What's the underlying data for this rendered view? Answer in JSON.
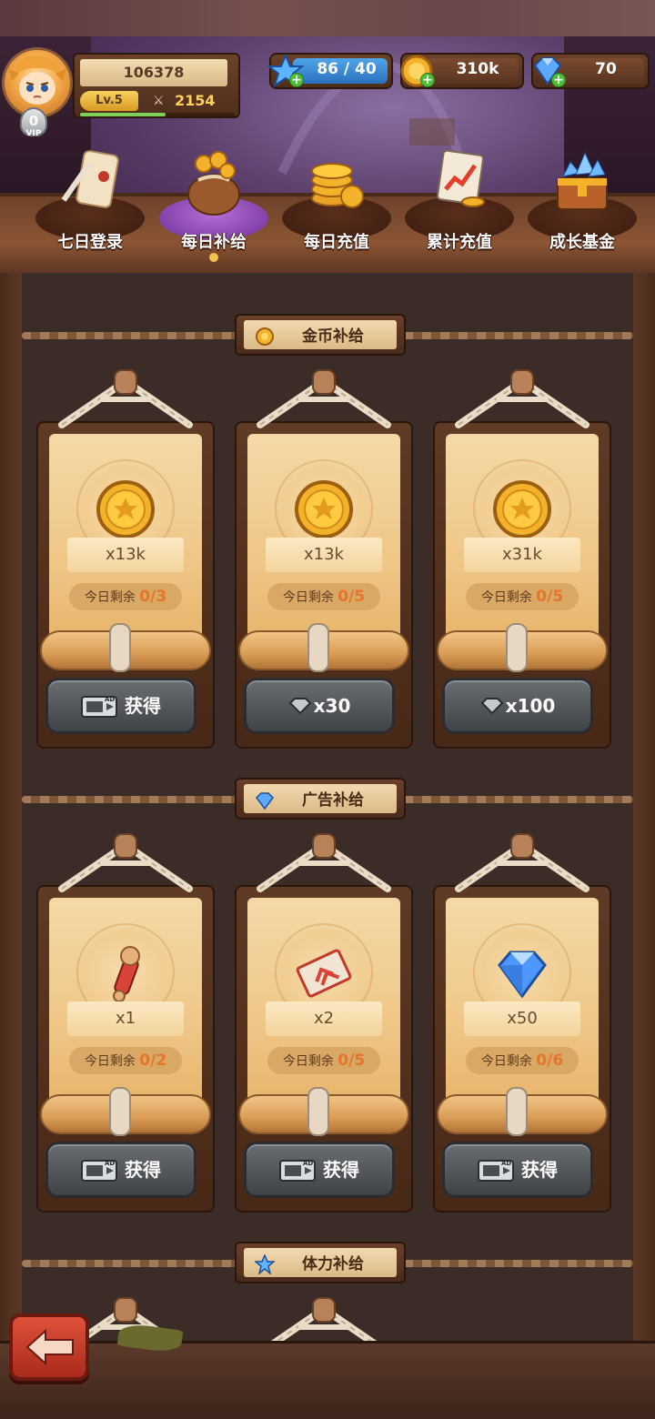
{
  "profile": {
    "player_id": "106378",
    "level": "Lv.5",
    "power": "2154",
    "vip_level": "0",
    "vip_label": "VIP",
    "xp_progress": 0.55
  },
  "resources": {
    "stamina": "86 / 40",
    "gold": "310k",
    "gems": "70"
  },
  "tabs": [
    {
      "label": "七日登录",
      "icon": "scroll-quill-icon",
      "active": false
    },
    {
      "label": "每日补给",
      "icon": "coin-bag-icon",
      "active": true
    },
    {
      "label": "每日充值",
      "icon": "coin-stack-icon",
      "active": false
    },
    {
      "label": "累计充值",
      "icon": "chart-clipboard-icon",
      "active": false
    },
    {
      "label": "成长基金",
      "icon": "gem-chest-icon",
      "active": false
    }
  ],
  "sections": [
    {
      "title": "金币补给",
      "icon": "coin-icon",
      "cards": [
        {
          "item": "gold-coin",
          "qty": "x13k",
          "remain_label": "今日剩余",
          "remain": "0/3",
          "button": {
            "type": "ad",
            "label": "获得"
          }
        },
        {
          "item": "gold-coin",
          "qty": "x13k",
          "remain_label": "今日剩余",
          "remain": "0/5",
          "button": {
            "type": "gem",
            "label": "x30"
          }
        },
        {
          "item": "gold-coin",
          "qty": "x31k",
          "remain_label": "今日剩余",
          "remain": "0/5",
          "button": {
            "type": "gem",
            "label": "x100"
          }
        }
      ]
    },
    {
      "title": "广告补给",
      "icon": "gem-icon",
      "cards": [
        {
          "item": "scroll-rod",
          "qty": "x1",
          "remain_label": "今日剩余",
          "remain": "0/2",
          "button": {
            "type": "ad",
            "label": "获得"
          }
        },
        {
          "item": "ticket",
          "qty": "x2",
          "remain_label": "今日剩余",
          "remain": "0/5",
          "button": {
            "type": "ad",
            "label": "获得"
          }
        },
        {
          "item": "blue-gem",
          "qty": "x50",
          "remain_label": "今日剩余",
          "remain": "0/6",
          "button": {
            "type": "ad",
            "label": "获得"
          }
        }
      ]
    },
    {
      "title": "体力补给",
      "icon": "star-icon",
      "cards": []
    }
  ],
  "ad_badge": "AD",
  "colors": {
    "accent_orange": "#e6752c",
    "gold_text": "#ffd15a",
    "active_tab": "#8a45b8",
    "back_button": "#c73a26"
  }
}
